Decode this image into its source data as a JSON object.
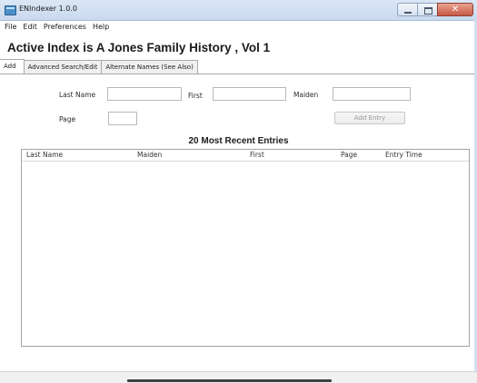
{
  "window": {
    "title": "ENIndexer 1.0.0"
  },
  "menu": [
    "File",
    "Edit",
    "Preferences",
    "Help"
  ],
  "page_title": "Active Index is A Jones Family History , Vol 1",
  "tabs": [
    "Add",
    "Advanced Search/Edit",
    "Alternate Names (See Also)"
  ],
  "form": {
    "last_name_label": "Last Name",
    "first_label": "First",
    "maiden_label": "Maiden",
    "page_label": "Page",
    "last_name_value": "",
    "first_value": "",
    "maiden_value": "",
    "page_value": "",
    "add_entry_label": "Add Entry"
  },
  "recent": {
    "title": "20 Most Recent Entries",
    "columns": [
      "Last Name",
      "Maiden",
      "First",
      "Page",
      "Entry Time"
    ],
    "rows": []
  }
}
